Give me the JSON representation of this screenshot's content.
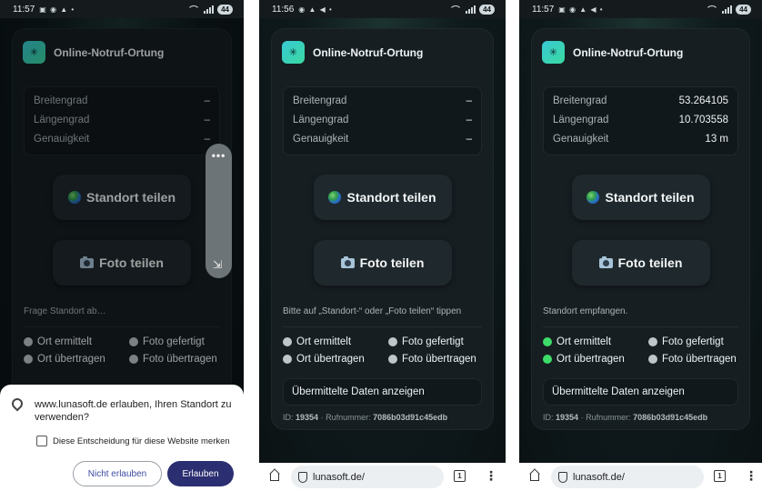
{
  "app": {
    "title": "Online-Notruf-Ortung",
    "logo_glyph": "✳",
    "labels": {
      "lat": "Breitengrad",
      "lon": "Längengrad",
      "acc": "Genauigkeit"
    },
    "share_location": "Standort teilen",
    "share_photo": "Foto teilen",
    "steps": [
      "Ort ermittelt",
      "Foto gefertigt",
      "Ort übertragen",
      "Foto übertragen"
    ],
    "data_button": "Übermittelte Daten anzeigen",
    "id_label": "ID:",
    "id_value": "19354",
    "separator": "·",
    "phone_label": "Rufnummer:",
    "phone_value": "7086b03d91c45edb"
  },
  "colors": {
    "done": "#3ddc68",
    "pending": "#bfc6c9",
    "accent": "#2b2e70"
  },
  "screens": [
    {
      "time": "11:57",
      "battery": "44",
      "lat": "–",
      "lon": "–",
      "acc": "–",
      "status": "Frage Standort ab…",
      "steps_done": [
        false,
        false,
        false,
        false
      ]
    },
    {
      "time": "11:56",
      "battery": "44",
      "lat": "–",
      "lon": "–",
      "acc": "–",
      "status": "Bitte auf „Standort-“ oder „Foto teilen“ tippen",
      "steps_done": [
        false,
        false,
        false,
        false
      ],
      "url": "lunasoft.de/",
      "tab_count": "1"
    },
    {
      "time": "11:57",
      "battery": "44",
      "lat": "53.264105",
      "lon": "10.703558",
      "acc": "13 m",
      "status": "Standort empfangen.",
      "steps_done": [
        true,
        false,
        true,
        false
      ],
      "url": "lunasoft.de/",
      "tab_count": "1"
    }
  ],
  "permission": {
    "message": "www.lunasoft.de erlauben, Ihren Standort zu verwenden?",
    "remember": "Diese Entscheidung für diese Website merken",
    "deny": "Nicht erlauben",
    "allow": "Erlauben"
  },
  "handle": {
    "dots": "•••",
    "icon": "⇲"
  }
}
